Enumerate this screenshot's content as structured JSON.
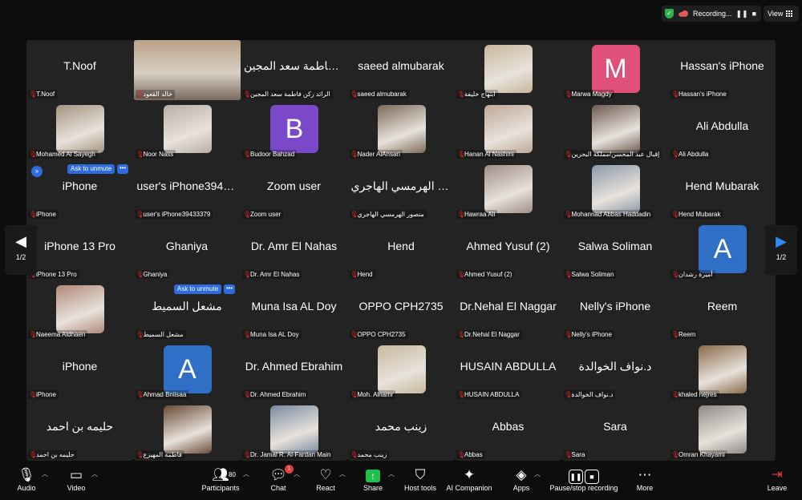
{
  "topbar": {
    "recording_label": "Recording...",
    "pause_glyph": "❚❚",
    "stop_glyph": "■",
    "view_label": "View"
  },
  "colors": {
    "accent": "#2d6cdf",
    "active_speaker": "#21c04a",
    "muted": "#e02828"
  },
  "gallery": {
    "page_label_left": "1/2",
    "page_label_right": "1/2",
    "ask_to_unmute": "Ask to unmute",
    "more_glyph": "•••",
    "tiles": [
      {
        "big": "T.Noof",
        "name": "T.Noof"
      },
      {
        "video": true,
        "name": "خالد القعود"
      },
      {
        "big": "الرائد ركن فاطمة سعد المجين",
        "name": "الرائد ركن فاطمة سعد المجين"
      },
      {
        "big": "saeed almubarak",
        "name": "saeed almubarak"
      },
      {
        "photo": "#c9b79b",
        "name": "ابتهاج خليفة"
      },
      {
        "letter": "M",
        "color": "#e0507a",
        "name": "Marwa Magdy"
      },
      {
        "big": "Hassan's iPhone",
        "name": "Hassan's iPhone"
      },
      {
        "photo": "#a59481",
        "name": "Mohamed Al Sayegh"
      },
      {
        "photo": "#b9aea5",
        "name": "Noor Nass"
      },
      {
        "letter": "B",
        "color": "#7a48c8",
        "name": "Budoor Bahzad"
      },
      {
        "photo": "#7c6a59",
        "name": "Nader AlAnsari"
      },
      {
        "photo": "#c0a897",
        "name": "Hanan Al Nashmi"
      },
      {
        "photo": "#6e5a50",
        "name": "إقبال عبد المحسن/مملكة البحرين"
      },
      {
        "big": "Ali Abdulla",
        "name": "Ali Abdulla"
      },
      {
        "big": "iPhone",
        "name": "iPhone"
      },
      {
        "big": "user's iPhone39433379",
        "name": "user's iPhone39433379"
      },
      {
        "big": "Zoom user",
        "name": "Zoom user"
      },
      {
        "big": "منصور الهرمسي الهاجري",
        "name": "منصور الهرمسي الهاجري"
      },
      {
        "photo": "#9e8e86",
        "name": "Hawraa Ali"
      },
      {
        "photo": "#8c98a8",
        "name": "Mohannad Abbas Haddadin"
      },
      {
        "big": "Hend Mubarak",
        "name": "Hend Mubarak"
      },
      {
        "big": "iPhone 13 Pro",
        "name": "iPhone 13 Pro"
      },
      {
        "big": "Ghaniya",
        "name": "Ghaniya"
      },
      {
        "big": "Dr. Amr El Nahas",
        "name": "Dr. Amr El Nahas"
      },
      {
        "big": "Hend",
        "name": "Hend"
      },
      {
        "big": "Ahmed Yusuf (2)",
        "name": "Ahmed Yusuf (2)"
      },
      {
        "big": "Salwa Soliman",
        "name": "Salwa Soliman"
      },
      {
        "letter": "A",
        "color": "#2f6fc6",
        "name": "أميرة رشدان"
      },
      {
        "photo": "#b08a7a",
        "name": "Naeema Aldhaen"
      },
      {
        "big": "مشعل السميط",
        "name": "مشعل السميط"
      },
      {
        "big": "Muna Isa AL Doy",
        "name": "Muna Isa AL Doy"
      },
      {
        "big": "OPPO CPH2735",
        "name": "OPPO CPH2735"
      },
      {
        "big": "Dr.Nehal El Naggar",
        "name": "Dr.Nehal El Naggar"
      },
      {
        "big": "Nelly's iPhone",
        "name": "Nelly's iPhone"
      },
      {
        "big": "Reem",
        "name": "Reem"
      },
      {
        "big": "iPhone",
        "name": "iPhone"
      },
      {
        "letter": "A",
        "color": "#2f6fc6",
        "name": "Ahmad Bniisaa"
      },
      {
        "big": "Dr. Ahmed Ebrahim",
        "name": "Dr. Ahmed Ebrahim"
      },
      {
        "photo": "#c8b89e",
        "name": "Moh. Alhamr"
      },
      {
        "big": "HUSAIN ABDULLA",
        "name": "HUSAIN ABDULLA"
      },
      {
        "big": "د.نواف الخوالدة",
        "name": "د.نواف الخوالدة"
      },
      {
        "photo": "#8a6a4a",
        "name": "khaled hejres"
      },
      {
        "big": "حليمه بن احمد",
        "name": "حليمه بن احمد"
      },
      {
        "photo": "#6a4a36",
        "name": "فاطمة المهيزع"
      },
      {
        "photo": "#7a8aa0",
        "name": "Dr. Jamal R. Al-Fardan Main"
      },
      {
        "big": "زينب محمد",
        "name": "زينب محمد"
      },
      {
        "big": "Abbas",
        "name": "Abbas"
      },
      {
        "big": "Sara",
        "name": "Sara"
      },
      {
        "photo": "#8f8a86",
        "name": "Omran Khayami"
      }
    ]
  },
  "toolbar": {
    "audio": "Audio",
    "video": "Video",
    "participants": "Participants",
    "participants_count": "80",
    "chat": "Chat",
    "chat_badge": "1",
    "react": "React",
    "share": "Share",
    "host_tools": "Host tools",
    "ai_companion": "AI Companion",
    "apps": "Apps",
    "pause_stop": "Pause/stop recording",
    "more": "More",
    "leave": "Leave"
  }
}
